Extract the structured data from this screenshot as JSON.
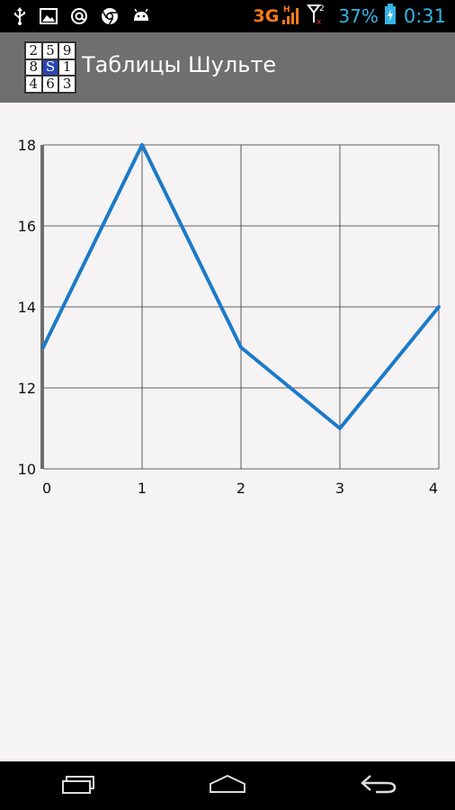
{
  "status_bar": {
    "icons_left": [
      "usb-icon",
      "image-icon",
      "at-sign-icon",
      "chrome-icon",
      "android-icon"
    ],
    "network_type": "3G",
    "signal_label": "H",
    "data_indicator": "x",
    "second_sim": "2",
    "battery_percent": "37%",
    "time": "0:31",
    "colors": {
      "network_type": "#ff7a1a",
      "battery": "#33b5e5",
      "time": "#33b5e5"
    }
  },
  "action_bar": {
    "title": "Таблицы Шульте",
    "logo_grid": [
      "2",
      "5",
      "9",
      "8",
      "S",
      "1",
      "4",
      "6",
      "3"
    ],
    "colors": {
      "background": "#6f6f6f",
      "logo_center": "#2946b8"
    }
  },
  "chart_data": {
    "type": "line",
    "x": [
      0,
      1,
      2,
      3,
      4
    ],
    "series": [
      {
        "values": [
          13,
          18,
          13,
          11,
          14
        ],
        "color": "#1b7ac8"
      }
    ],
    "xlim": [
      0,
      4
    ],
    "ylim": [
      10,
      18
    ],
    "x_ticks": [
      "0",
      "1",
      "2",
      "3",
      "4"
    ],
    "y_ticks": [
      "10",
      "12",
      "14",
      "16",
      "18"
    ],
    "title": "",
    "xlabel": "",
    "ylabel": "",
    "grid": true
  },
  "nav_bar": {
    "buttons": [
      "recent-apps-icon",
      "home-icon",
      "back-icon"
    ]
  }
}
